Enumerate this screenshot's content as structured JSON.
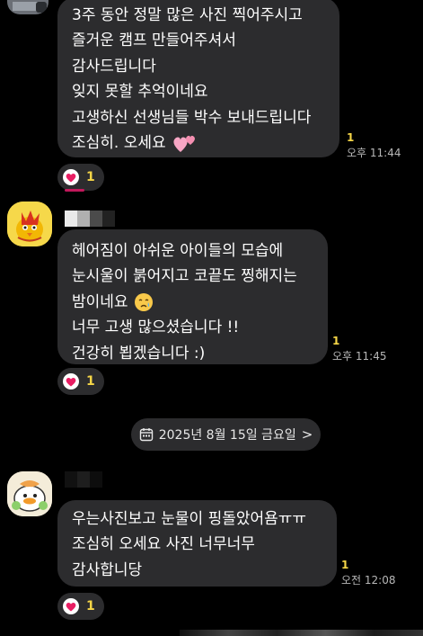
{
  "messages": [
    {
      "lines": [
        "3주 동안 정말  많은 사진  찍어주시고",
        "즐거운 캠프  만들어주셔서",
        "감사드립니다",
        "잊지 못할 추억이네요",
        "고생하신 선생님들 박수 보내드립니다",
        "조심히. 오세요"
      ],
      "unread": "1",
      "time": "오후 11:44",
      "reaction_count": "1"
    },
    {
      "lines": [
        "헤어짐이 아쉬운 아이들의 모습에",
        "눈시울이 붉어지고 코끝도 찡해지는",
        "밤이네요",
        "너무 고생 많으셨습니다 !!",
        "건강히 뵙겠습니다 :)"
      ],
      "unread": "1",
      "time": "오후 11:45",
      "reaction_count": "1"
    },
    {
      "lines": [
        "우는사진보고 눈물이 핑돌았어욤ㅠㅠ",
        "조심히 오세요 사진 너무너무",
        "감사합니당"
      ],
      "unread": "1",
      "time": "오전 12:08",
      "reaction_count": "1"
    }
  ],
  "date_divider": {
    "label": "2025년 8월 15일 금요일",
    "icon": "calendar-icon",
    "chevron": ">"
  },
  "colors": {
    "background": "#000000",
    "bubble": "#2c2c2e",
    "unread": "#f5d547",
    "time": "#b7b7b7",
    "reaction_heart": "#e91e63"
  }
}
